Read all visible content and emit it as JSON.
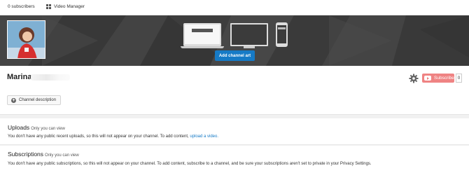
{
  "topbar": {
    "subscribers": "0 subscribers",
    "video_manager": "Video Manager"
  },
  "banner": {
    "add_art_label": "Add channel art"
  },
  "channel": {
    "name": "Marina",
    "subscribe_label": "Subscribe",
    "subscriber_count": "0",
    "description_button": "Channel description"
  },
  "uploads": {
    "title": "Uploads",
    "visibility": "Only you can view",
    "message": "You don't have any public recent uploads, so this will not appear on your channel. To add content,",
    "link": "upload a video."
  },
  "subscriptions": {
    "title": "Subscriptions",
    "visibility": "Only you can view",
    "message": "You don't have any public subscriptions, so this will not appear on your channel. To add content, subscribe to a channel, and be sure your subscriptions aren't set to private in your Privacy Settings."
  },
  "colors": {
    "accent": "#167ac6",
    "subscribe": "#ef8383",
    "banner": "#3d3d3d"
  }
}
